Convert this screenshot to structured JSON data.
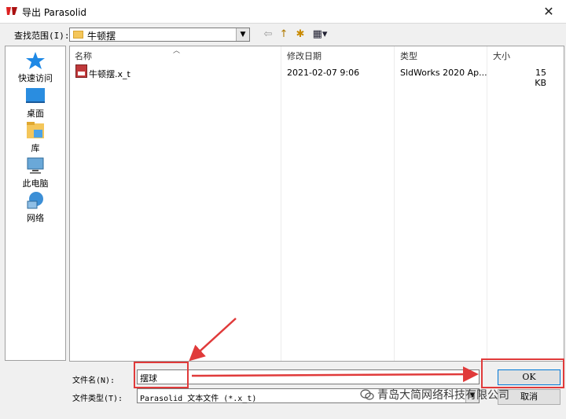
{
  "window": {
    "title": "导出 Parasolid"
  },
  "lookin": {
    "label": "查找范围(I):",
    "value": "牛顿摆"
  },
  "toolbar": {
    "back_glyph": "⇦",
    "up_glyph": "↑",
    "newfolder_glyph": "✱",
    "view_glyph": "▦▾"
  },
  "places": [
    {
      "label": "快速访问",
      "icon": "star-icon"
    },
    {
      "label": "桌面",
      "icon": "desktop-icon"
    },
    {
      "label": "库",
      "icon": "library-icon"
    },
    {
      "label": "此电脑",
      "icon": "computer-icon"
    },
    {
      "label": "网络",
      "icon": "network-icon"
    }
  ],
  "columns": {
    "name": "名称",
    "date": "修改日期",
    "type": "类型",
    "size": "大小"
  },
  "files": [
    {
      "name": "牛顿摆.x_t",
      "date": "2021-02-07 9:06",
      "type": "SldWorks 2020 Ap...",
      "size": "15 KB"
    }
  ],
  "filename": {
    "label": "文件名(N):",
    "value": "摆球"
  },
  "filetype": {
    "label": "文件类型(T):",
    "value": "Parasolid 文本文件 (*.x_t)"
  },
  "buttons": {
    "ok": "OK",
    "cancel": "取消"
  },
  "watermark": "青岛大简网络科技有限公司",
  "colors": {
    "highlight": "#e03a3a",
    "accent": "#0078d7"
  }
}
